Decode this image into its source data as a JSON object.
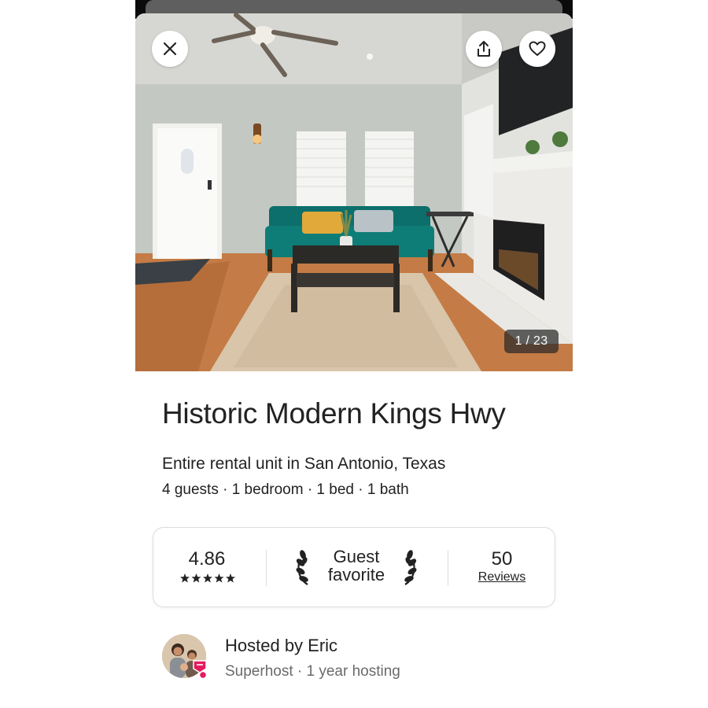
{
  "hero": {
    "photo_counter": "1 / 23",
    "close_icon": "close-icon",
    "share_icon": "share-icon",
    "favorite_icon": "heart-icon"
  },
  "listing": {
    "title": "Historic Modern Kings Hwy",
    "subtitle": "Entire rental unit in San Antonio, Texas",
    "details": "4 guests · 1 bedroom · 1 bed · 1 bath"
  },
  "stats": {
    "rating": "4.86",
    "stars": 5,
    "guest_favorite_line1": "Guest",
    "guest_favorite_line2": "favorite",
    "reviews_count": "50",
    "reviews_label": "Reviews"
  },
  "host": {
    "name": "Hosted by Eric",
    "meta": "Superhost · 1 year hosting",
    "badge_color": "#E31C5F"
  }
}
